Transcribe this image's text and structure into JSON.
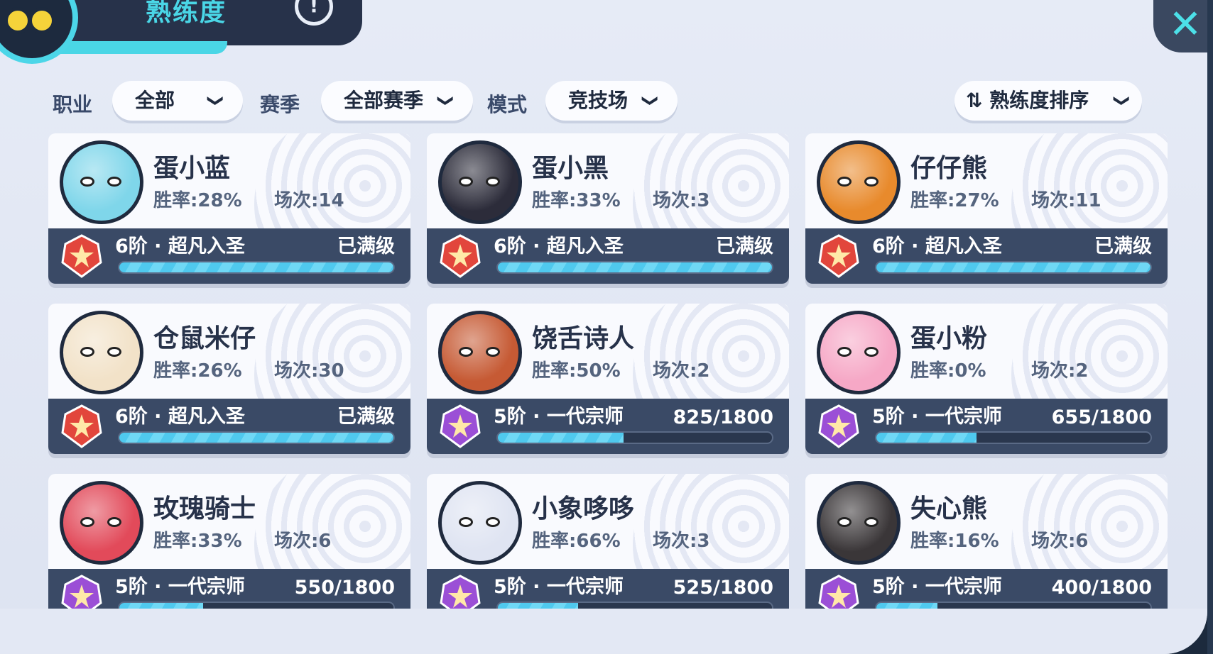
{
  "header": {
    "title": "熟练度",
    "info": "!"
  },
  "close": "✕",
  "filters": {
    "profession_label": "职业",
    "profession_value": "全部",
    "season_label": "赛季",
    "season_value": "全部赛季",
    "mode_label": "模式",
    "mode_value": "竞技场",
    "sort_value": "⇅ 熟练度排序",
    "chevron": "❯"
  },
  "cards": [
    {
      "name": "蛋小蓝",
      "win": "胜率:28%",
      "games": "场次:14",
      "rank": "6阶 · 超凡入圣",
      "progress": "已满级",
      "fill": 1.0,
      "tier": 6,
      "avatar_color": "#7fd6ea"
    },
    {
      "name": "蛋小黑",
      "win": "胜率:33%",
      "games": "场次:3",
      "rank": "6阶 · 超凡入圣",
      "progress": "已满级",
      "fill": 1.0,
      "tier": 6,
      "avatar_color": "#2c2c3a"
    },
    {
      "name": "仔仔熊",
      "win": "胜率:27%",
      "games": "场次:11",
      "rank": "6阶 · 超凡入圣",
      "progress": "已满级",
      "fill": 1.0,
      "tier": 6,
      "avatar_color": "#e88a2c"
    },
    {
      "name": "仓鼠米仔",
      "win": "胜率:26%",
      "games": "场次:30",
      "rank": "6阶 · 超凡入圣",
      "progress": "已满级",
      "fill": 1.0,
      "tier": 6,
      "avatar_color": "#f2e2c8"
    },
    {
      "name": "饶舌诗人",
      "win": "胜率:50%",
      "games": "场次:2",
      "rank": "5阶 · 一代宗师",
      "progress": "825/1800",
      "fill": 0.458,
      "tier": 5,
      "avatar_color": "#c65a34"
    },
    {
      "name": "蛋小粉",
      "win": "胜率:0%",
      "games": "场次:2",
      "rank": "5阶 · 一代宗师",
      "progress": "655/1800",
      "fill": 0.364,
      "tier": 5,
      "avatar_color": "#f6a8c6"
    },
    {
      "name": "玫瑰骑士",
      "win": "胜率:33%",
      "games": "场次:6",
      "rank": "5阶 · 一代宗师",
      "progress": "550/1800",
      "fill": 0.306,
      "tier": 5,
      "avatar_color": "#e24a5a"
    },
    {
      "name": "小象哆哆",
      "win": "胜率:66%",
      "games": "场次:3",
      "rank": "5阶 · 一代宗师",
      "progress": "525/1800",
      "fill": 0.292,
      "tier": 5,
      "avatar_color": "#dfe4f2"
    },
    {
      "name": "失心熊",
      "win": "胜率:16%",
      "games": "场次:6",
      "rank": "5阶 · 一代宗师",
      "progress": "400/1800",
      "fill": 0.222,
      "tier": 5,
      "avatar_color": "#3a3638"
    }
  ],
  "colors": {
    "tier6_badge": "#e2463c",
    "tier5_badge": "#9b4fd6",
    "bar_fill": "#4fc9ee",
    "accent": "#4ad6e6"
  }
}
